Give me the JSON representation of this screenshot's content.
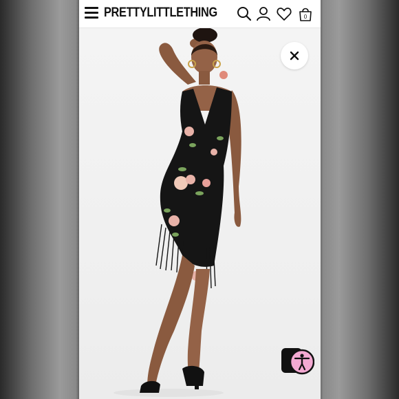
{
  "header": {
    "brand": "PRETTYLITTLETHING",
    "bag_count": "0",
    "icons": [
      "menu-icon",
      "search-icon",
      "account-icon",
      "wishlist-icon",
      "bag-icon"
    ]
  },
  "product_view": {
    "image_description_icon": "model-photo",
    "close_icon": "close-icon",
    "accessibility_icon": "accessibility-icon"
  },
  "colors": {
    "brand_text": "#111111",
    "accessibility_pink": "#f3a9d2",
    "dress_black": "#151515",
    "flower_pink": "#e8b2a8",
    "leaf_green": "#7aa35c"
  }
}
